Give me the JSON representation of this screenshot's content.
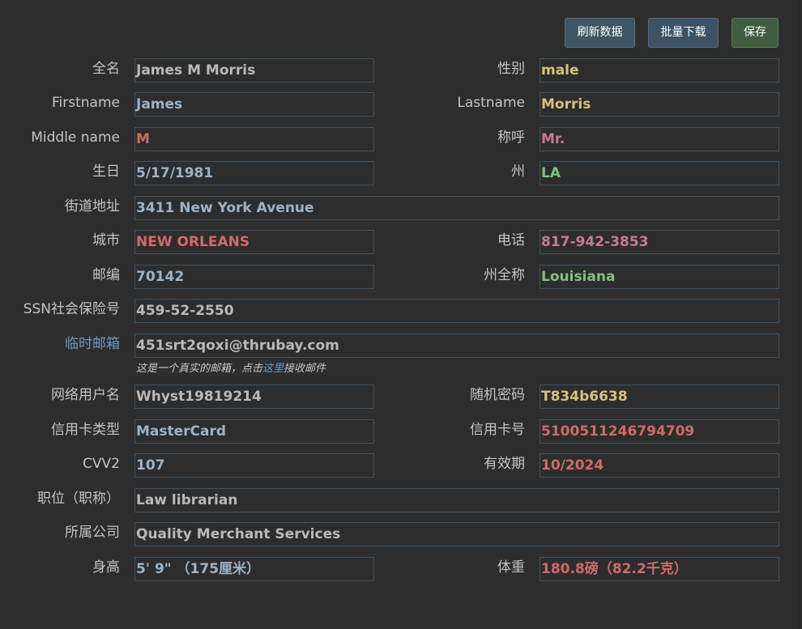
{
  "toolbar": {
    "refresh_label": "刷新数据",
    "batch_download_label": "批量下载",
    "save_label": "保存"
  },
  "profile": {
    "fullname": {
      "label": "全名",
      "value": "James M Morris"
    },
    "gender": {
      "label": "性别",
      "value": "male"
    },
    "firstname": {
      "label": "Firstname",
      "value": "James"
    },
    "lastname": {
      "label": "Lastname",
      "value": "Morris"
    },
    "middlename": {
      "label": "Middle name",
      "value": "M"
    },
    "title": {
      "label": "称呼",
      "value": "Mr."
    },
    "birthday": {
      "label": "生日",
      "value": "5/17/1981"
    },
    "state": {
      "label": "州",
      "value": "LA"
    },
    "street": {
      "label": "街道地址",
      "value": "3411 New York Avenue"
    },
    "city": {
      "label": "城市",
      "value": "NEW ORLEANS"
    },
    "phone": {
      "label": "电话",
      "value": "817-942-3853"
    },
    "zip": {
      "label": "邮编",
      "value": "70142"
    },
    "state_full": {
      "label": "州全称",
      "value": "Louisiana"
    },
    "ssn": {
      "label": "SSN社会保险号",
      "value": "459-52-2550"
    },
    "temp_email": {
      "label": "临时邮箱",
      "value": "451srt2qoxi@thrubay.com",
      "hint_prefix": "这是一个真实的邮箱，点击",
      "hint_link": "这里",
      "hint_suffix": "接收邮件"
    },
    "username": {
      "label": "网络用户名",
      "value": "Whyst19819214"
    },
    "password": {
      "label": "随机密码",
      "value": "T834b6638"
    },
    "card_type": {
      "label": "信用卡类型",
      "value": "MasterCard"
    },
    "card_number": {
      "label": "信用卡号",
      "value": "5100511246794709"
    },
    "cvv": {
      "label": "CVV2",
      "value": "107"
    },
    "expiry": {
      "label": "有效期",
      "value": "10/2024"
    },
    "occupation": {
      "label": "职位（职称）",
      "value": "Law librarian"
    },
    "company": {
      "label": "所属公司",
      "value": "Quality Merchant Services"
    },
    "height": {
      "label": "身高",
      "value": "5' 9\"  （175厘米）"
    },
    "weight": {
      "label": "体重",
      "value": "180.8磅（82.2千克）"
    }
  },
  "colors": {
    "background": "#2d2d2d",
    "field_border": "#3e5466",
    "value_gray": "#b9b9b9",
    "value_blue": "#9db2c8",
    "value_gold": "#d9c07a",
    "value_red": "#d06a6a",
    "value_pink": "#c77a93",
    "value_green": "#7dc47d",
    "link": "#6c9ac4"
  }
}
